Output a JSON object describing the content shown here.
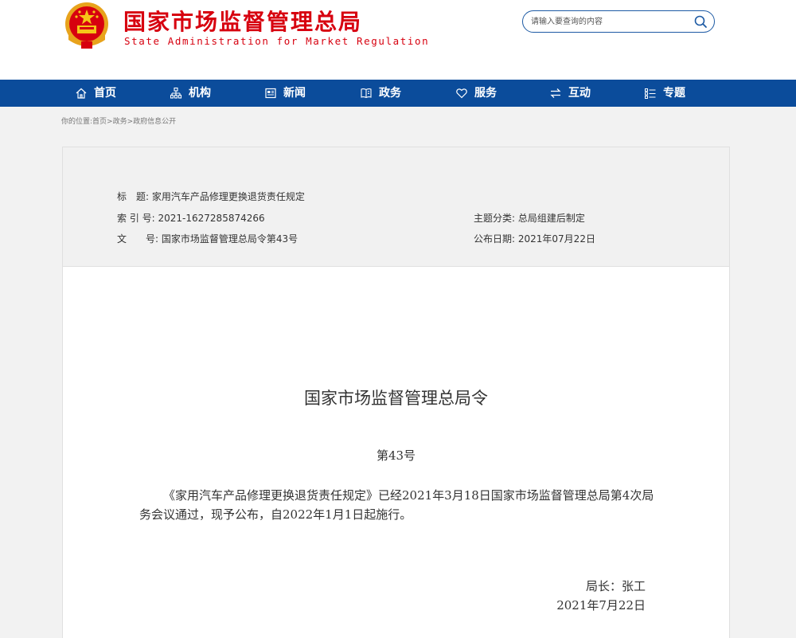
{
  "header": {
    "site_name": "国家市场监督管理总局",
    "site_name_en": "State Administration for Market Regulation",
    "search_placeholder": "请输入要查询的内容",
    "brand_color": "#d7000f"
  },
  "nav": {
    "background": "#0b4c9b",
    "items": [
      {
        "label": "首页",
        "icon": "home-icon"
      },
      {
        "label": "机构",
        "icon": "org-chart-icon"
      },
      {
        "label": "新闻",
        "icon": "news-icon"
      },
      {
        "label": "政务",
        "icon": "book-icon"
      },
      {
        "label": "服务",
        "icon": "heart-icon"
      },
      {
        "label": "互动",
        "icon": "exchange-icon"
      },
      {
        "label": "专题",
        "icon": "list-icon"
      }
    ]
  },
  "breadcrumb": "你的位置:首页>政务>政府信息公开",
  "meta": {
    "title_label": "标　题:",
    "title_value": "家用汽车产品修理更换退货责任规定",
    "index_label": "索 引 号:",
    "index_value": "2021-1627285874266",
    "doc_no_label": "文　　号:",
    "doc_no_value": "国家市场监督管理总局令第43号",
    "category_label": "主题分类:",
    "category_value": "总局组建后制定",
    "date_label": "公布日期:",
    "date_value": "2021年07月22日"
  },
  "document": {
    "heading": "国家市场监督管理总局令",
    "number": "第43号",
    "body": "《家用汽车产品修理更换退货责任规定》已经2021年3月18日国家市场监督管理总局第4次局务会议通过，现予公布，自2022年1月1日起施行。",
    "signatory": "局长：张工",
    "sign_date": "2021年7月22日"
  }
}
